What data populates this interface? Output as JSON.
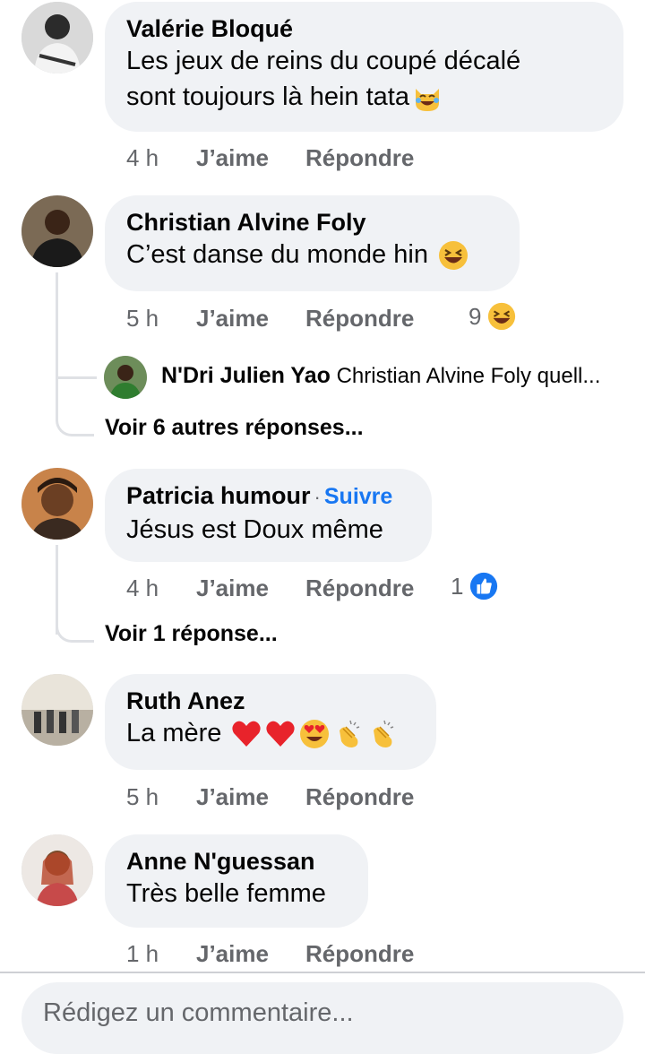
{
  "comments": [
    {
      "author": "Valérie Bloqué",
      "text": "Les jeux de reins du coupé décalé",
      "text_line2": "sont toujours là hein tata",
      "emoji": "joy-cat-emoji",
      "time": "4 h",
      "like": "J’aime",
      "reply": "Répondre"
    },
    {
      "author": "Christian Alvine Foly",
      "text": "C’est danse du monde hin",
      "emoji": "laughing-emoji",
      "time": "5 h",
      "like": "J’aime",
      "reply": "Répondre",
      "reaction_count": "9",
      "reaction_icon": "laughing-emoji",
      "preview_reply": {
        "author": "N'Dri Julien Yao",
        "text": "Christian Alvine Foly quell..."
      },
      "more_replies": "Voir 6 autres réponses..."
    },
    {
      "author": "Patricia humour",
      "separator": "·",
      "follow": "Suivre",
      "text": "Jésus est Doux même",
      "time": "4 h",
      "like": "J’aime",
      "reply": "Répondre",
      "reaction_count": "1",
      "reaction_icon": "thumbs-up-icon",
      "more_replies": "Voir 1 réponse..."
    },
    {
      "author": "Ruth Anez",
      "text": "La mère",
      "emojis": [
        "heart-emoji",
        "heart-emoji",
        "heart-eyes-emoji",
        "clapping-hands-emoji",
        "clapping-hands-emoji"
      ],
      "time": "5 h",
      "like": "J’aime",
      "reply": "Répondre"
    },
    {
      "author": "Anne N'guessan",
      "text": "Très belle femme",
      "time": "1 h",
      "like": "J’aime",
      "reply": "Répondre"
    }
  ],
  "composer": {
    "placeholder": "Rédigez un commentaire..."
  },
  "colors": {
    "bubble": "#f0f2f5",
    "meta": "#65676b",
    "link": "#1877f2",
    "thread": "#dfe1e5"
  }
}
